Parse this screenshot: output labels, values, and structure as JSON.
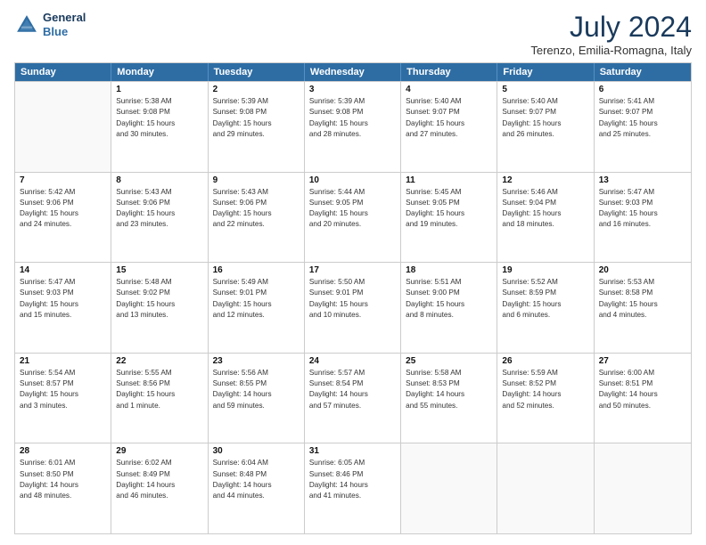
{
  "header": {
    "logo_line1": "General",
    "logo_line2": "Blue",
    "month": "July 2024",
    "location": "Terenzo, Emilia-Romagna, Italy"
  },
  "days": [
    "Sunday",
    "Monday",
    "Tuesday",
    "Wednesday",
    "Thursday",
    "Friday",
    "Saturday"
  ],
  "weeks": [
    [
      {
        "num": "",
        "empty": true
      },
      {
        "num": "1",
        "rise": "5:38 AM",
        "set": "9:08 PM",
        "daylight": "15 hours and 30 minutes."
      },
      {
        "num": "2",
        "rise": "5:39 AM",
        "set": "9:08 PM",
        "daylight": "15 hours and 29 minutes."
      },
      {
        "num": "3",
        "rise": "5:39 AM",
        "set": "9:08 PM",
        "daylight": "15 hours and 28 minutes."
      },
      {
        "num": "4",
        "rise": "5:40 AM",
        "set": "9:07 PM",
        "daylight": "15 hours and 27 minutes."
      },
      {
        "num": "5",
        "rise": "5:40 AM",
        "set": "9:07 PM",
        "daylight": "15 hours and 26 minutes."
      },
      {
        "num": "6",
        "rise": "5:41 AM",
        "set": "9:07 PM",
        "daylight": "15 hours and 25 minutes."
      }
    ],
    [
      {
        "num": "7",
        "rise": "5:42 AM",
        "set": "9:06 PM",
        "daylight": "15 hours and 24 minutes."
      },
      {
        "num": "8",
        "rise": "5:43 AM",
        "set": "9:06 PM",
        "daylight": "15 hours and 23 minutes."
      },
      {
        "num": "9",
        "rise": "5:43 AM",
        "set": "9:06 PM",
        "daylight": "15 hours and 22 minutes."
      },
      {
        "num": "10",
        "rise": "5:44 AM",
        "set": "9:05 PM",
        "daylight": "15 hours and 20 minutes."
      },
      {
        "num": "11",
        "rise": "5:45 AM",
        "set": "9:05 PM",
        "daylight": "15 hours and 19 minutes."
      },
      {
        "num": "12",
        "rise": "5:46 AM",
        "set": "9:04 PM",
        "daylight": "15 hours and 18 minutes."
      },
      {
        "num": "13",
        "rise": "5:47 AM",
        "set": "9:03 PM",
        "daylight": "15 hours and 16 minutes."
      }
    ],
    [
      {
        "num": "14",
        "rise": "5:47 AM",
        "set": "9:03 PM",
        "daylight": "15 hours and 15 minutes."
      },
      {
        "num": "15",
        "rise": "5:48 AM",
        "set": "9:02 PM",
        "daylight": "15 hours and 13 minutes."
      },
      {
        "num": "16",
        "rise": "5:49 AM",
        "set": "9:01 PM",
        "daylight": "15 hours and 12 minutes."
      },
      {
        "num": "17",
        "rise": "5:50 AM",
        "set": "9:01 PM",
        "daylight": "15 hours and 10 minutes."
      },
      {
        "num": "18",
        "rise": "5:51 AM",
        "set": "9:00 PM",
        "daylight": "15 hours and 8 minutes."
      },
      {
        "num": "19",
        "rise": "5:52 AM",
        "set": "8:59 PM",
        "daylight": "15 hours and 6 minutes."
      },
      {
        "num": "20",
        "rise": "5:53 AM",
        "set": "8:58 PM",
        "daylight": "15 hours and 4 minutes."
      }
    ],
    [
      {
        "num": "21",
        "rise": "5:54 AM",
        "set": "8:57 PM",
        "daylight": "15 hours and 3 minutes."
      },
      {
        "num": "22",
        "rise": "5:55 AM",
        "set": "8:56 PM",
        "daylight": "15 hours and 1 minute."
      },
      {
        "num": "23",
        "rise": "5:56 AM",
        "set": "8:55 PM",
        "daylight": "14 hours and 59 minutes."
      },
      {
        "num": "24",
        "rise": "5:57 AM",
        "set": "8:54 PM",
        "daylight": "14 hours and 57 minutes."
      },
      {
        "num": "25",
        "rise": "5:58 AM",
        "set": "8:53 PM",
        "daylight": "14 hours and 55 minutes."
      },
      {
        "num": "26",
        "rise": "5:59 AM",
        "set": "8:52 PM",
        "daylight": "14 hours and 52 minutes."
      },
      {
        "num": "27",
        "rise": "6:00 AM",
        "set": "8:51 PM",
        "daylight": "14 hours and 50 minutes."
      }
    ],
    [
      {
        "num": "28",
        "rise": "6:01 AM",
        "set": "8:50 PM",
        "daylight": "14 hours and 48 minutes."
      },
      {
        "num": "29",
        "rise": "6:02 AM",
        "set": "8:49 PM",
        "daylight": "14 hours and 46 minutes."
      },
      {
        "num": "30",
        "rise": "6:04 AM",
        "set": "8:48 PM",
        "daylight": "14 hours and 44 minutes."
      },
      {
        "num": "31",
        "rise": "6:05 AM",
        "set": "8:46 PM",
        "daylight": "14 hours and 41 minutes."
      },
      {
        "num": "",
        "empty": true
      },
      {
        "num": "",
        "empty": true
      },
      {
        "num": "",
        "empty": true
      }
    ]
  ]
}
